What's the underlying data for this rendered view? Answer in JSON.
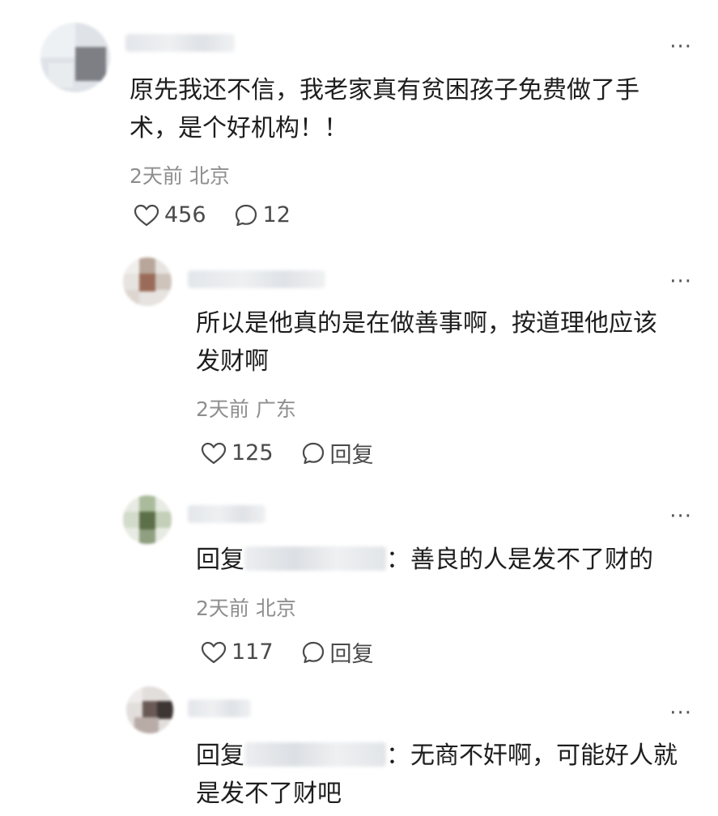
{
  "comments": [
    {
      "text": "原先我还不信，我老家真有贫困孩子免费做了手术，是个好机构！！",
      "line1": "原先我还不信，我老家真有贫困孩子免费做了手",
      "line2": "术，是个好机构！！",
      "time": "2天前",
      "location": "北京",
      "likes": "456",
      "replies": "12",
      "more": "···"
    },
    {
      "line1": "所以是他真的是在做善事啊，按道理他应该",
      "line2": "发财啊",
      "time": "2天前",
      "location": "广东",
      "likes": "125",
      "reply_label": "回复",
      "more": "···"
    },
    {
      "reply_prefix": "回复",
      "reply_text": "：善良的人是发不了财的",
      "time": "2天前",
      "location": "北京",
      "likes": "117",
      "reply_label": "回复",
      "more": "···"
    },
    {
      "reply_prefix": "回复",
      "line1_rest": "：无商不奸啊，可能好人就",
      "line2": "是发不了财吧",
      "more": "···"
    }
  ],
  "icons": {
    "like": "heart-outline-icon",
    "comment": "speech-bubble-icon",
    "more": "more-dots-icon"
  }
}
